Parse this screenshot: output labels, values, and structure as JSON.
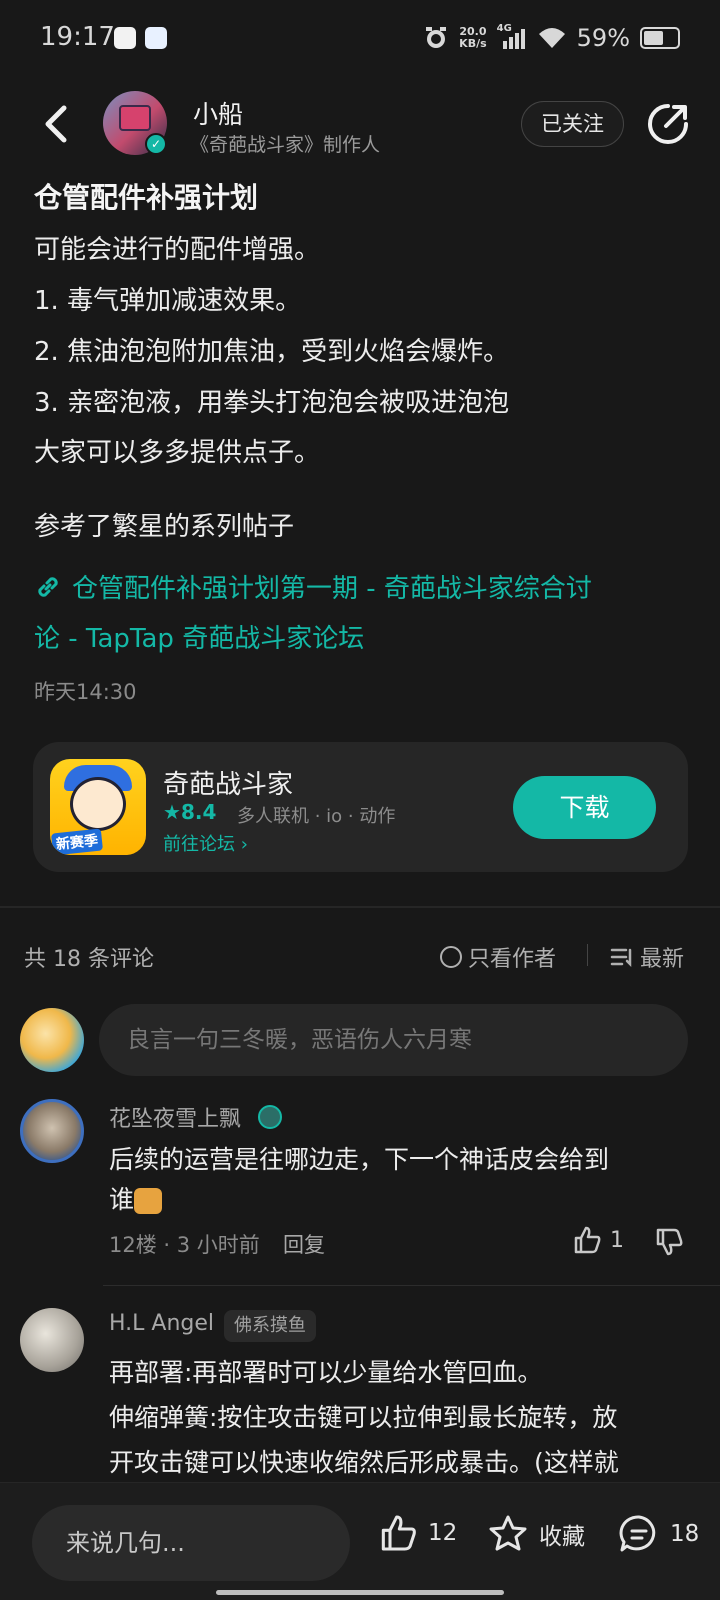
{
  "status_bar": {
    "time": "19:17",
    "net_speed_value": "20.0",
    "net_speed_unit": "KB/s",
    "network": "4G",
    "battery": "59%",
    "battery_level": 0.59
  },
  "header": {
    "author_name": "小船",
    "author_role": "《奇葩战斗家》制作人",
    "follow_label": "已关注"
  },
  "post": {
    "title": "仓管配件补强计划",
    "lines": [
      "可能会进行的配件增强。",
      "1. 毒气弹加减速效果。",
      "2. 焦油泡泡附加焦油，受到火焰会爆炸。",
      "3. 亲密泡液，用拳头打泡泡会被吸进泡泡",
      "大家可以多多提供点子。",
      "参考了繁星的系列帖子"
    ],
    "link_line1": "仓管配件补强计划第一期 - 奇葩战斗家综合讨",
    "link_line2": "论 - TapTap 奇葩战斗家论坛",
    "time": "昨天14:30"
  },
  "app_card": {
    "name": "奇葩战斗家",
    "icon_badge": "新赛季",
    "rating": "8.4",
    "tags": "多人联机 · io · 动作",
    "forum_link": "前往论坛",
    "download_label": "下载"
  },
  "comments_header": {
    "count": "共 18 条评论",
    "only_author": "只看作者",
    "sort": "最新"
  },
  "comment_input": {
    "placeholder": "良言一句三冬暖，恶语伤人六月寒"
  },
  "comments": [
    {
      "name": "花坠夜雪上飘",
      "text_line1": "后续的运营是往哪边走，下一个神话皮会给到",
      "text_line2": "谁",
      "meta": "12楼 · 3 小时前",
      "reply": "回复",
      "likes": "1"
    },
    {
      "name": "H.L Angel",
      "tag": "佛系摸鱼",
      "text_line1": "再部署:再部署时可以少量给水管回血。",
      "text_line2": "伸缩弹簧:按住攻击键可以拉伸到最长旋转，放",
      "text_line3": "开攻击键可以快速收缩然后形成暴击。(这样就"
    }
  ],
  "bottom_bar": {
    "input_placeholder": "来说几句...",
    "likes": "12",
    "favorite": "收藏",
    "comments": "18"
  },
  "colors": {
    "accent": "#14b8a6",
    "background": "#181818",
    "card": "#262626"
  },
  "icons": [
    "back-arrow-icon",
    "share-icon",
    "verified-icon",
    "link-icon",
    "star-icon",
    "chevron-right-icon",
    "radio-circle-icon",
    "sort-icon",
    "thumb-up-icon",
    "thumb-down-icon",
    "favorite-star-icon",
    "comment-icon"
  ]
}
